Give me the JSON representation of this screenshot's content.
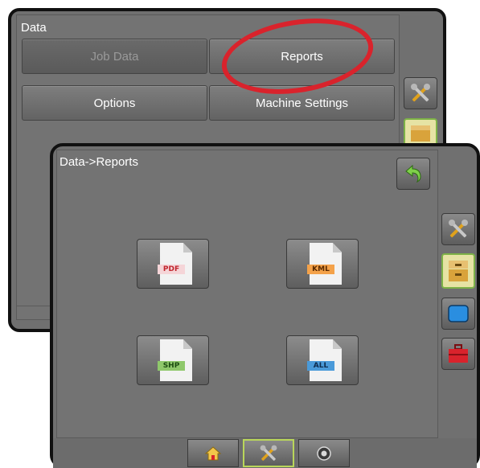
{
  "back_screen": {
    "title": "Data",
    "menu": {
      "job_data": "Job Data",
      "reports": "Reports",
      "options": "Options",
      "machine_settings": "Machine Settings"
    },
    "highlight_color": "#d9232c"
  },
  "front_screen": {
    "title": "Data->Reports",
    "files": [
      {
        "label": "PDF",
        "tag_bg": "#f5d5d8",
        "tag_fg": "#c0262e"
      },
      {
        "label": "KML",
        "tag_bg": "#f4a24a",
        "tag_fg": "#5a2a00"
      },
      {
        "label": "SHP",
        "tag_bg": "#8fc86b",
        "tag_fg": "#1d4d12"
      },
      {
        "label": "ALL",
        "tag_bg": "#4a9ad9",
        "tag_fg": "#0e2c4f"
      }
    ],
    "side_icons": [
      "tools-icon",
      "data-folder-icon",
      "display-icon",
      "toolbox-icon"
    ],
    "bottom_nav": [
      "home-icon",
      "tools-icon",
      "camera-icon"
    ]
  },
  "colors": {
    "panel_bg": "#707070",
    "accent_green": "#7db247"
  }
}
